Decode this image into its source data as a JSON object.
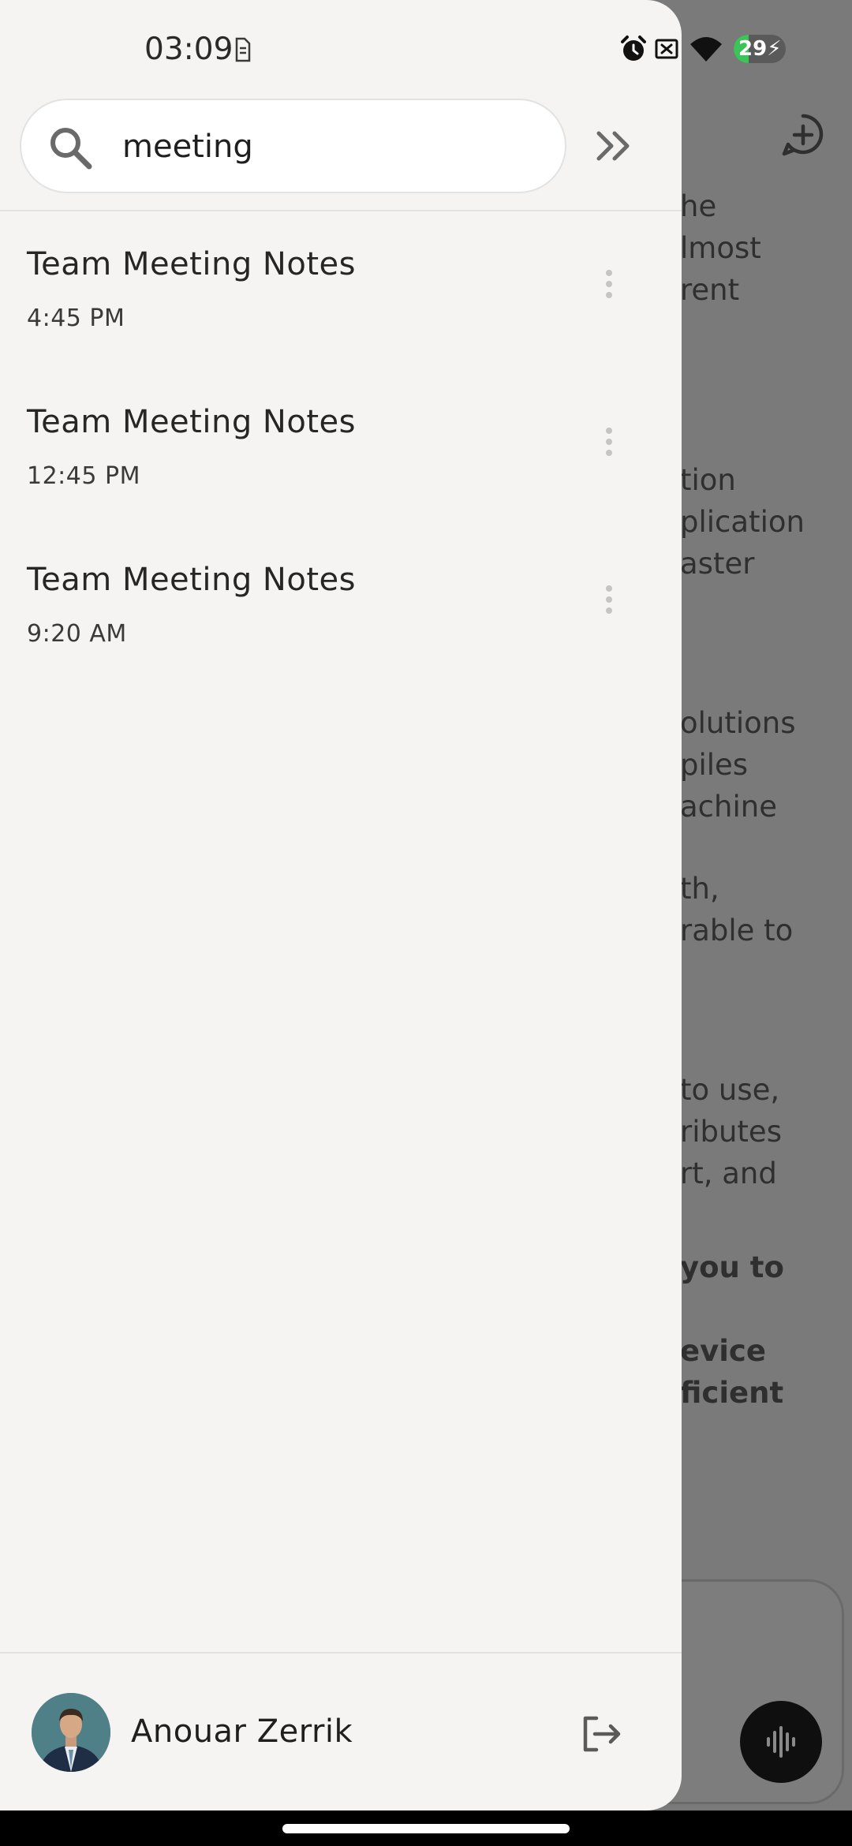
{
  "status_bar": {
    "time": "03:09",
    "battery": "29",
    "battery_level": 0.29
  },
  "search": {
    "value": "meeting",
    "placeholder": ""
  },
  "conversations": [
    {
      "title": "Team Meeting Notes",
      "time": "4:45 PM"
    },
    {
      "title": "Team Meeting Notes",
      "time": "12:45 PM"
    },
    {
      "title": "Team Meeting Notes",
      "time": "9:20 AM"
    }
  ],
  "user": {
    "name": "Anouar Zerrik"
  },
  "background_text": {
    "lines": [
      {
        "text": "he",
        "bold": false
      },
      {
        "text": "lmost",
        "bold": false
      },
      {
        "text": "rent",
        "bold": false
      },
      {
        "text": "tion",
        "bold": false
      },
      {
        "text": "plication",
        "bold": false
      },
      {
        "text": "aster",
        "bold": false
      },
      {
        "text": "olutions",
        "bold": false
      },
      {
        "text": "piles",
        "bold": false
      },
      {
        "text": "achine",
        "bold": false
      },
      {
        "text": "th,",
        "bold": false
      },
      {
        "text": "rable to",
        "bold": false
      },
      {
        "text": "to use,",
        "bold": false
      },
      {
        "text": "ributes",
        "bold": false
      },
      {
        "text": "rt, and",
        "bold": false
      },
      {
        "text": "you to",
        "bold": true
      },
      {
        "text": "evice",
        "bold": true
      },
      {
        "text": "ficient",
        "bold": true
      }
    ]
  },
  "icons": {
    "status_left": "sim-card-icon",
    "status_right": [
      "alarm-icon",
      "no-sim-icon",
      "wifi-icon"
    ],
    "search": "search-icon",
    "collapse": "double-chevron-right-icon",
    "item_menu": "more-vertical-icon",
    "logout": "logout-icon",
    "new_chat": "new-chat-icon",
    "voice": "voice-waveform-icon"
  },
  "colors": {
    "drawer_bg": "#f5f4f2",
    "scrim": "#7a7a7a",
    "battery_green": "#3cc35a"
  }
}
